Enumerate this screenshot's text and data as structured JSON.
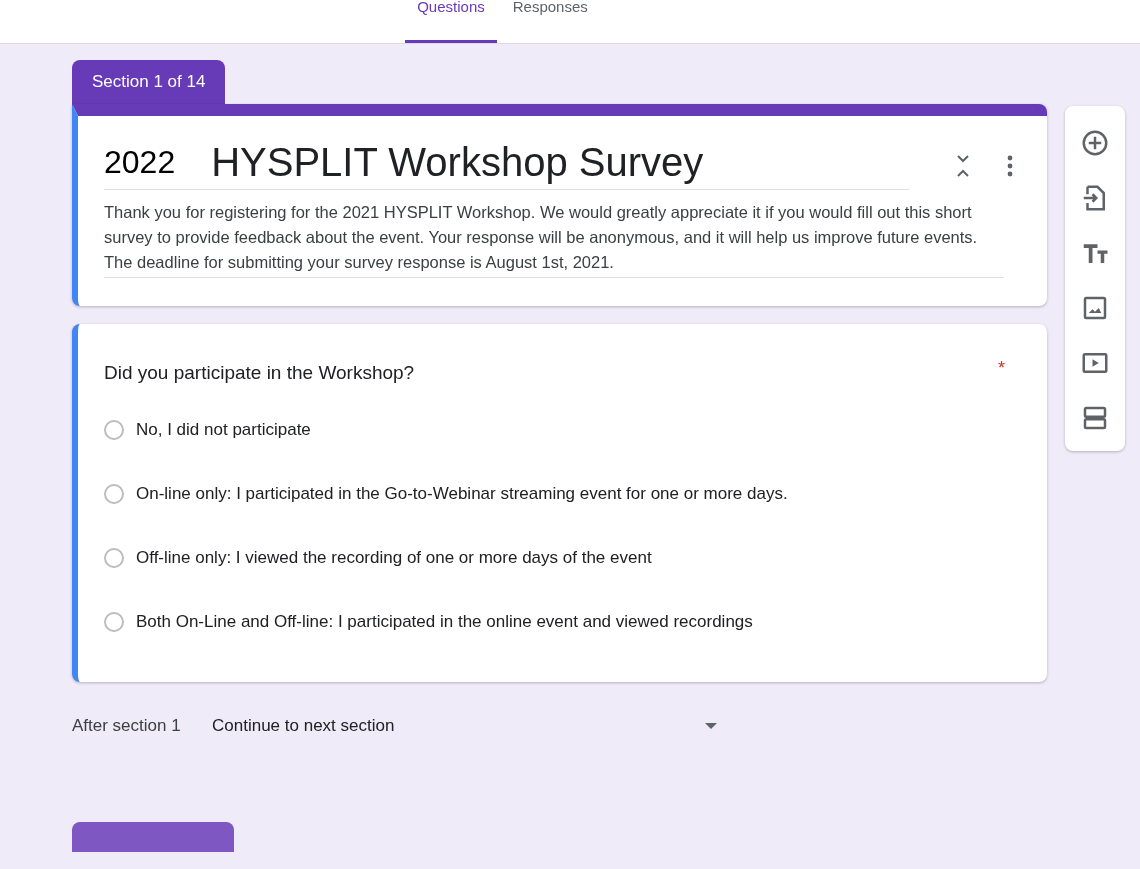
{
  "tabs": [
    {
      "label": "Questions",
      "selected": true
    },
    {
      "label": "Responses",
      "selected": false
    }
  ],
  "section": {
    "tab_label": "Section 1 of 14",
    "year": "2022",
    "title": "HYSPLIT Workshop Survey",
    "description": "Thank you for registering for the 2021 HYSPLIT Workshop. We would greatly appreciate it if you would fill out this short survey to provide feedback about the event. Your response will be anonymous, and it will help us improve future events. The deadline for submitting your survey response is August 1st, 2021."
  },
  "question": {
    "title": "Did you participate in the Workshop?",
    "required": true,
    "required_mark": "*",
    "options": [
      {
        "label": "No, I did not participate",
        "selected": false
      },
      {
        "label": "On-line only: I participated in the Go-to-Webinar streaming event for one or more days.",
        "selected": false
      },
      {
        "label": "Off-line only: I viewed the recording of one or more days of the event",
        "selected": false
      },
      {
        "label": "Both On-Line and Off-line: I participated in the online event and viewed recordings",
        "selected": false
      }
    ]
  },
  "after_section": {
    "label": "After section 1",
    "value": "Continue to next section"
  },
  "toolbar": [
    {
      "kind": "add"
    },
    {
      "kind": "import"
    },
    {
      "kind": "title"
    },
    {
      "kind": "image"
    },
    {
      "kind": "video"
    },
    {
      "kind": "section"
    }
  ]
}
